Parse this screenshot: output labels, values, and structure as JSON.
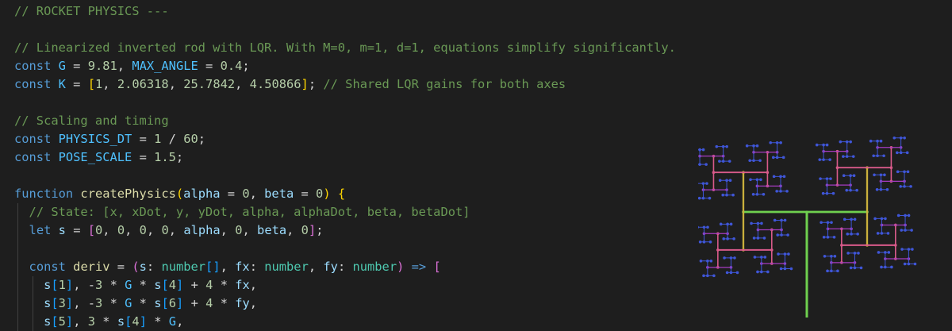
{
  "code": {
    "lines": [
      [
        {
          "t": "// ROCKET PHYSICS ---",
          "c": "c"
        }
      ],
      [],
      [
        {
          "t": "// Linearized inverted rod with LQR. With M=0, m=1, d=1, equations simplify significantly.",
          "c": "c"
        }
      ],
      [
        {
          "t": "const",
          "c": "k"
        },
        {
          "t": " "
        },
        {
          "t": "G",
          "c": "cn"
        },
        {
          "t": " = "
        },
        {
          "t": "9.81",
          "c": "n"
        },
        {
          "t": ", "
        },
        {
          "t": "MAX_ANGLE",
          "c": "cn"
        },
        {
          "t": " = "
        },
        {
          "t": "0.4",
          "c": "n"
        },
        {
          "t": ";"
        }
      ],
      [
        {
          "t": "const",
          "c": "k"
        },
        {
          "t": " "
        },
        {
          "t": "K",
          "c": "cn"
        },
        {
          "t": " = "
        },
        {
          "t": "[",
          "c": "b1"
        },
        {
          "t": "1",
          "c": "n"
        },
        {
          "t": ", "
        },
        {
          "t": "2.06318",
          "c": "n"
        },
        {
          "t": ", "
        },
        {
          "t": "25.7842",
          "c": "n"
        },
        {
          "t": ", "
        },
        {
          "t": "4.50866",
          "c": "n"
        },
        {
          "t": "]",
          "c": "b1"
        },
        {
          "t": "; "
        },
        {
          "t": "// Shared LQR gains for both axes",
          "c": "c"
        }
      ],
      [],
      [
        {
          "t": "// Scaling and timing",
          "c": "c"
        }
      ],
      [
        {
          "t": "const",
          "c": "k"
        },
        {
          "t": " "
        },
        {
          "t": "PHYSICS_DT",
          "c": "cn"
        },
        {
          "t": " = "
        },
        {
          "t": "1",
          "c": "n"
        },
        {
          "t": " / "
        },
        {
          "t": "60",
          "c": "n"
        },
        {
          "t": ";"
        }
      ],
      [
        {
          "t": "const",
          "c": "k"
        },
        {
          "t": " "
        },
        {
          "t": "POSE_SCALE",
          "c": "cn"
        },
        {
          "t": " = "
        },
        {
          "t": "1.5",
          "c": "n"
        },
        {
          "t": ";"
        }
      ],
      [],
      [
        {
          "t": "function",
          "c": "k"
        },
        {
          "t": " "
        },
        {
          "t": "createPhysics",
          "c": "f"
        },
        {
          "t": "(",
          "c": "b1"
        },
        {
          "t": "alpha",
          "c": "v"
        },
        {
          "t": " = "
        },
        {
          "t": "0",
          "c": "n"
        },
        {
          "t": ", "
        },
        {
          "t": "beta",
          "c": "v"
        },
        {
          "t": " = "
        },
        {
          "t": "0",
          "c": "n"
        },
        {
          "t": ")",
          "c": "b1"
        },
        {
          "t": " "
        },
        {
          "t": "{",
          "c": "b1"
        }
      ],
      [
        {
          "t": "  "
        },
        {
          "t": "// State: [x, xDot, y, yDot, alpha, alphaDot, beta, betaDot]",
          "c": "c"
        }
      ],
      [
        {
          "t": "  "
        },
        {
          "t": "let",
          "c": "k"
        },
        {
          "t": " "
        },
        {
          "t": "s",
          "c": "v"
        },
        {
          "t": " = "
        },
        {
          "t": "[",
          "c": "b2"
        },
        {
          "t": "0",
          "c": "n"
        },
        {
          "t": ", "
        },
        {
          "t": "0",
          "c": "n"
        },
        {
          "t": ", "
        },
        {
          "t": "0",
          "c": "n"
        },
        {
          "t": ", "
        },
        {
          "t": "0",
          "c": "n"
        },
        {
          "t": ", "
        },
        {
          "t": "alpha",
          "c": "v"
        },
        {
          "t": ", "
        },
        {
          "t": "0",
          "c": "n"
        },
        {
          "t": ", "
        },
        {
          "t": "beta",
          "c": "v"
        },
        {
          "t": ", "
        },
        {
          "t": "0",
          "c": "n"
        },
        {
          "t": "]",
          "c": "b2"
        },
        {
          "t": ";"
        }
      ],
      [],
      [
        {
          "t": "  "
        },
        {
          "t": "const",
          "c": "k"
        },
        {
          "t": " "
        },
        {
          "t": "deriv",
          "c": "f"
        },
        {
          "t": " = "
        },
        {
          "t": "(",
          "c": "b2"
        },
        {
          "t": "s",
          "c": "v"
        },
        {
          "t": ": "
        },
        {
          "t": "number",
          "c": "t"
        },
        {
          "t": "[]",
          "c": "b3"
        },
        {
          "t": ", "
        },
        {
          "t": "fx",
          "c": "v"
        },
        {
          "t": ": "
        },
        {
          "t": "number",
          "c": "t"
        },
        {
          "t": ", "
        },
        {
          "t": "fy",
          "c": "v"
        },
        {
          "t": ": "
        },
        {
          "t": "number",
          "c": "t"
        },
        {
          "t": ")",
          "c": "b2"
        },
        {
          "t": " "
        },
        {
          "t": "=>",
          "c": "k"
        },
        {
          "t": " "
        },
        {
          "t": "[",
          "c": "b2"
        }
      ],
      [
        {
          "t": "    "
        },
        {
          "t": "s",
          "c": "v"
        },
        {
          "t": "[",
          "c": "b3"
        },
        {
          "t": "1",
          "c": "n"
        },
        {
          "t": "]",
          "c": "b3"
        },
        {
          "t": ", -"
        },
        {
          "t": "3",
          "c": "n"
        },
        {
          "t": " * "
        },
        {
          "t": "G",
          "c": "cn"
        },
        {
          "t": " * "
        },
        {
          "t": "s",
          "c": "v"
        },
        {
          "t": "[",
          "c": "b3"
        },
        {
          "t": "4",
          "c": "n"
        },
        {
          "t": "]",
          "c": "b3"
        },
        {
          "t": " + "
        },
        {
          "t": "4",
          "c": "n"
        },
        {
          "t": " * "
        },
        {
          "t": "fx",
          "c": "v"
        },
        {
          "t": ","
        }
      ],
      [
        {
          "t": "    "
        },
        {
          "t": "s",
          "c": "v"
        },
        {
          "t": "[",
          "c": "b3"
        },
        {
          "t": "3",
          "c": "n"
        },
        {
          "t": "]",
          "c": "b3"
        },
        {
          "t": ", -"
        },
        {
          "t": "3",
          "c": "n"
        },
        {
          "t": " * "
        },
        {
          "t": "G",
          "c": "cn"
        },
        {
          "t": " * "
        },
        {
          "t": "s",
          "c": "v"
        },
        {
          "t": "[",
          "c": "b3"
        },
        {
          "t": "6",
          "c": "n"
        },
        {
          "t": "]",
          "c": "b3"
        },
        {
          "t": " + "
        },
        {
          "t": "4",
          "c": "n"
        },
        {
          "t": " * "
        },
        {
          "t": "fy",
          "c": "v"
        },
        {
          "t": ","
        }
      ],
      [
        {
          "t": "    "
        },
        {
          "t": "s",
          "c": "v"
        },
        {
          "t": "[",
          "c": "b3"
        },
        {
          "t": "5",
          "c": "n"
        },
        {
          "t": "]",
          "c": "b3"
        },
        {
          "t": ", "
        },
        {
          "t": "3",
          "c": "n"
        },
        {
          "t": " * "
        },
        {
          "t": "s",
          "c": "v"
        },
        {
          "t": "[",
          "c": "b3"
        },
        {
          "t": "4",
          "c": "n"
        },
        {
          "t": "]",
          "c": "b3"
        },
        {
          "t": " * "
        },
        {
          "t": "G",
          "c": "cn"
        },
        {
          "t": ","
        }
      ]
    ]
  },
  "colors": {
    "background": "#1e1e1e",
    "comment": "#6a9955",
    "keyword": "#569cd6",
    "function": "#dcdcaa",
    "number": "#b5cea8",
    "variable": "#9cdcfe",
    "constant": "#4fc1ff",
    "type": "#4ec9b0",
    "tree_trunk": "#6fd04f",
    "tree_mid": "#c9b03c",
    "tree_outer": "#d85a8a",
    "tree_leaf": "#a53cc0",
    "tree_tip": "#3f56d8"
  },
  "art": {
    "name": "h-tree-fractal"
  }
}
